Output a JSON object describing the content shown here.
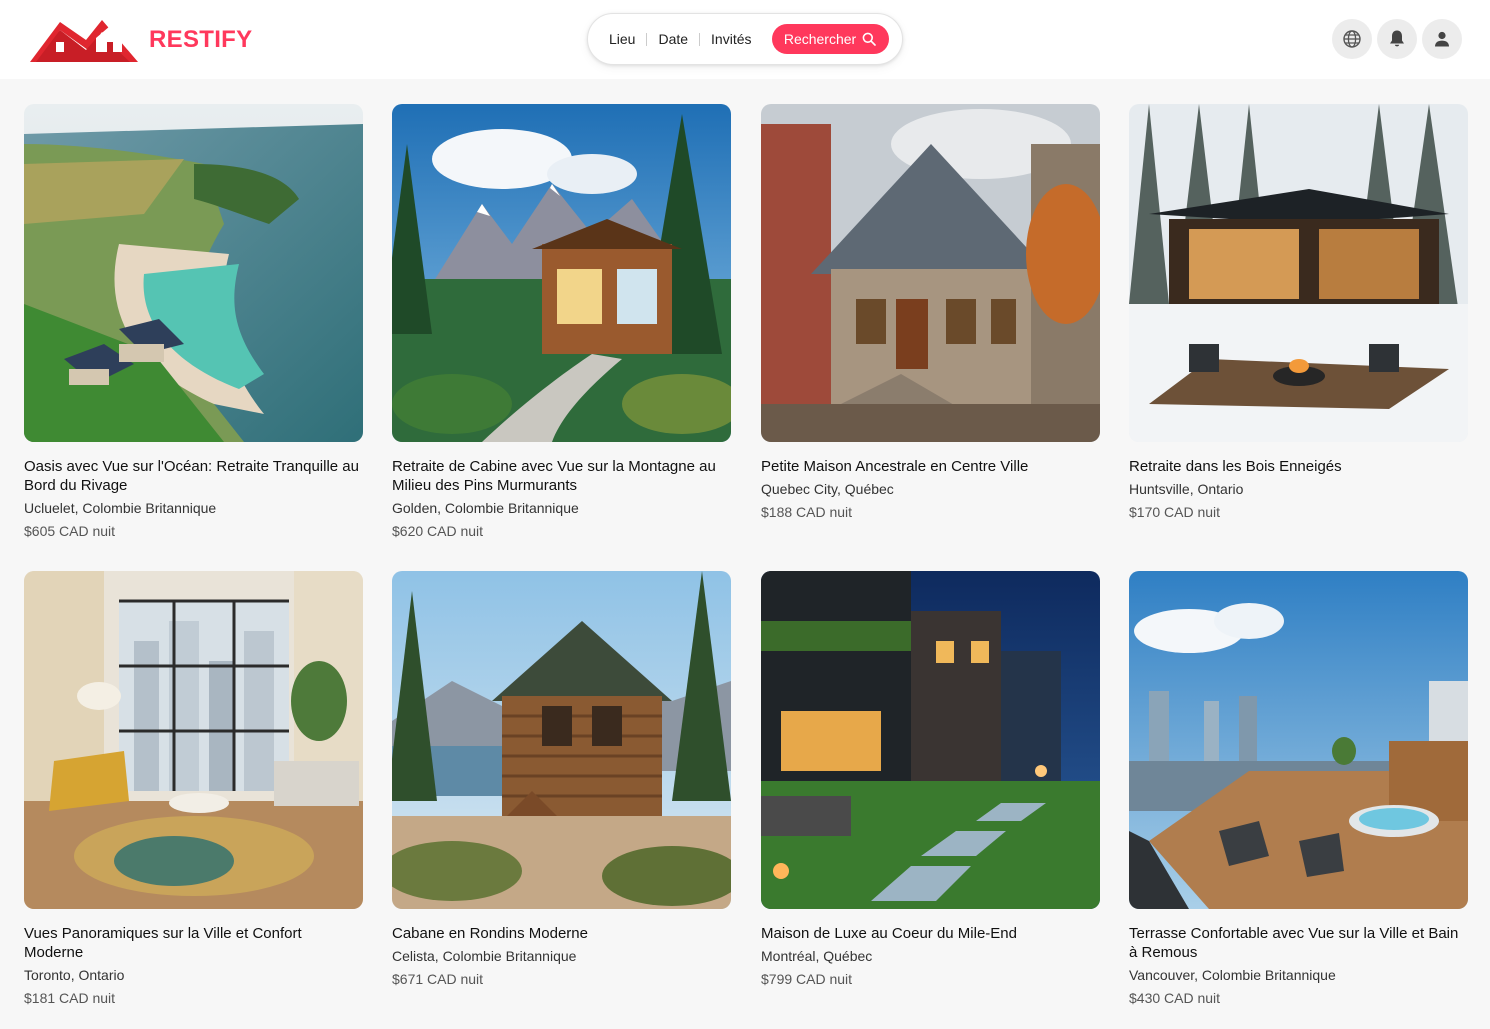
{
  "app": {
    "brand": "RESTIFY",
    "accent": "#ff385c"
  },
  "search": {
    "segments": [
      "Lieu",
      "Date",
      "Invités"
    ],
    "button_label": "Rechercher"
  },
  "header_icons": [
    "globe-icon",
    "bell-icon",
    "user-icon"
  ],
  "listings": [
    {
      "title": "Oasis avec Vue sur l'Océan: Retraite Tranquille au Bord du Rivage",
      "location": "Ucluelet, Colombie Britannique",
      "price": "$605 CAD nuit"
    },
    {
      "title": "Retraite de Cabine avec Vue sur la Montagne au Milieu des Pins Murmurants",
      "location": "Golden, Colombie Britannique",
      "price": "$620 CAD nuit"
    },
    {
      "title": "Petite Maison Ancestrale en Centre Ville",
      "location": "Quebec City, Québec",
      "price": "$188 CAD nuit"
    },
    {
      "title": "Retraite dans les Bois Enneigés",
      "location": "Huntsville, Ontario",
      "price": "$170 CAD nuit"
    },
    {
      "title": "Vues Panoramiques sur la Ville et Confort Moderne",
      "location": "Toronto, Ontario",
      "price": "$181 CAD nuit"
    },
    {
      "title": "Cabane en Rondins Moderne",
      "location": "Celista, Colombie Britannique",
      "price": "$671 CAD nuit"
    },
    {
      "title": "Maison de Luxe au Coeur du Mile-End",
      "location": "Montréal, Québec",
      "price": "$799 CAD nuit"
    },
    {
      "title": "Terrasse Confortable avec Vue sur la Ville et Bain à Remous",
      "location": "Vancouver, Colombie Britannique",
      "price": "$430 CAD nuit"
    }
  ]
}
